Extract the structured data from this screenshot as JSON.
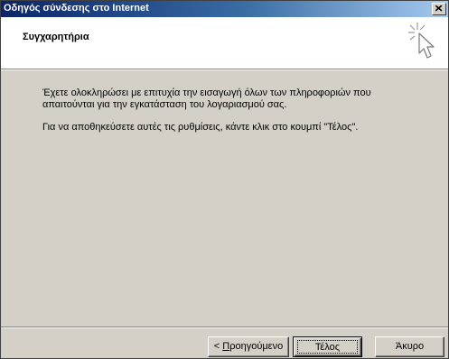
{
  "window": {
    "title": "Οδηγός σύνδεσης στο Internet"
  },
  "header": {
    "title": "Συγχαρητήρια",
    "icon": "wizard-cursor-icon"
  },
  "content": {
    "paragraph1": "Έχετε ολοκληρώσει με επιτυχία την εισαγωγή όλων των πληροφοριών που απαιτούνται για την εγκατάσταση του λογαριασμού σας.",
    "paragraph2": "Για να αποθηκεύσετε αυτές τις ρυθμίσεις, κάντε κλικ στο κουμπί \"Τέλος\"."
  },
  "buttons": {
    "back_prefix": "< ",
    "back_accel": "Π",
    "back_rest": "ροηγούμενο",
    "finish": "Τέλος",
    "cancel": "Άκυρο"
  }
}
